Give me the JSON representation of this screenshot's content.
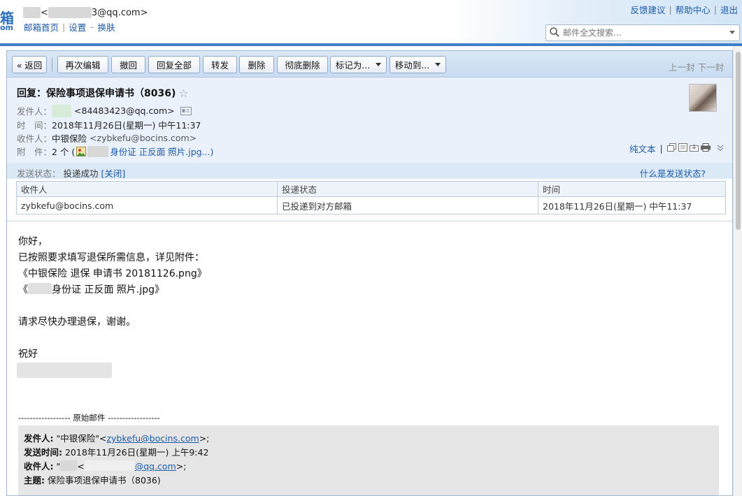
{
  "header": {
    "logo_glyph": "箱",
    "logo_sub": "om",
    "user_email_suffix": "3@qq.com>",
    "links": [
      "邮箱首页",
      "设置",
      "换肤"
    ],
    "link_sep": "|",
    "link_dash": "–",
    "right_links": [
      "反馈建议",
      "帮助中心",
      "退出"
    ],
    "search_placeholder": "邮件全文搜索..."
  },
  "toolbar": {
    "back": "« 返回",
    "buttons": [
      "再次编辑",
      "撤回",
      "回复全部",
      "转发",
      "删除",
      "彻底删除"
    ],
    "mark_as": "标记为...",
    "move_to": "移动到...",
    "prev": "上一封",
    "next": "下一封"
  },
  "mail": {
    "subject": "回复：保险事项退保申请书（8036)",
    "star": "☆",
    "from_label": "发件人：",
    "from_email": "<84483423@qq.com>",
    "time_label": "时　间：",
    "time_value": "2018年11月26日(星期一) 中午11:37",
    "to_label": "收件人：",
    "to_name": "中银保险",
    "to_email": "<zybkefu@bocins.com>",
    "attach_label": "附　件：",
    "attach_count": "2 个 (",
    "attach_name": "身份证 正反面 照片.jpg...)",
    "plaintext": "纯文本",
    "plaintext_sep": "|"
  },
  "status": {
    "label": "发送状态：",
    "value": "投递成功",
    "close": "[关闭]",
    "help": "什么是发送状态?",
    "columns": [
      "收件人",
      "投递状态",
      "时间"
    ],
    "rows": [
      [
        "zybkefu@bocins.com",
        "已投递到对方邮箱",
        "2018年11月26日(星期一) 中午11:37"
      ]
    ]
  },
  "body": {
    "lines": [
      "你好，",
      "已按照要求填写退保所需信息，详见附件：",
      "《中银保险 退保 申请书 20181126.png》",
      "身份证 正反面 照片.jpg》",
      "",
      "请求尽快办理退保，谢谢。",
      "",
      "祝好"
    ],
    "line4_prefix": "《"
  },
  "original": {
    "divider": "------------------ 原始邮件 ------------------",
    "from_label": "发件人:",
    "from_name": "\"中银保险\"<",
    "from_email": "zybkefu@bocins.com",
    "from_tail": ">;",
    "sent_label": "发送时间:",
    "sent_value": "2018年11月26日(星期一) 上午9:42",
    "to_label": "收件人:",
    "to_prefix": "\"",
    "to_mid": "<",
    "to_email": "@qq.com",
    "to_tail": ">;",
    "subject_label": "主题:",
    "subject_value": "保险事项退保申请书（8036)"
  }
}
